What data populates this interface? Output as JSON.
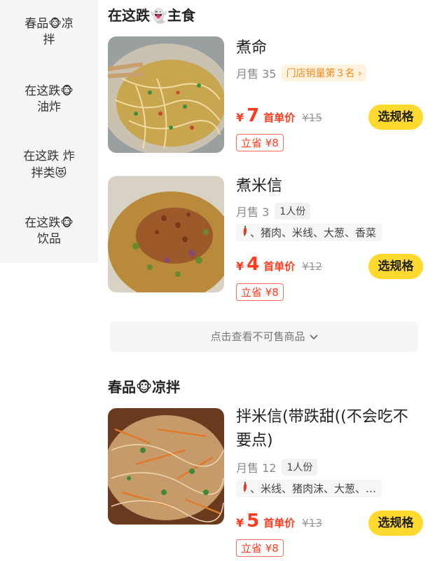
{
  "sidebar": {
    "items": [
      {
        "line1": "春品",
        "emoji1": "🐵",
        "line1b": "凉",
        "line2": "拌"
      },
      {
        "line1": "在这跌",
        "emoji1": "🐵",
        "line1b": "",
        "line2": "油炸"
      },
      {
        "line1": "在这跌 炸",
        "emoji1": "",
        "line1b": "",
        "line2": "拌类",
        "emoji2": "😻"
      },
      {
        "line1": "在这跌",
        "emoji1": "🐵",
        "line1b": "",
        "line2": "饮品"
      }
    ]
  },
  "sections": [
    {
      "title_pre": "在这跌",
      "title_emoji": "👻",
      "title_post": "主食"
    },
    {
      "title_pre": "春品",
      "title_emoji": "🐵",
      "title_post": "凉拌"
    }
  ],
  "dishes": [
    {
      "name": "煮命",
      "sales": "月售 35",
      "rank_badge": "门店销量第３名 ›",
      "currency": "¥",
      "price": "7",
      "price_unit": "首单价",
      "original_price": "¥15",
      "save": "立省 ¥8",
      "button": "选规格"
    },
    {
      "name": "煮米信",
      "sales": "月售 3",
      "serve": "1人份",
      "ingredients": "、猪肉、米线、大葱、香菜",
      "currency": "¥",
      "price": "4",
      "price_unit": "首单价",
      "original_price": "¥12",
      "save": "立省 ¥8",
      "button": "选规格"
    },
    {
      "name": "拌米信(带跌甜((不会吃不要点)",
      "sales": "月售 12",
      "serve": "1人份",
      "ingredients": "、米线、猪肉沫、大葱、…",
      "currency": "¥",
      "price": "5",
      "price_unit": "首单价",
      "original_price": "¥13",
      "save": "立省 ¥8",
      "button": "选规格"
    }
  ],
  "unsold_link": "点击查看不可售商品",
  "icons": {
    "chili": "chili-pepper-icon",
    "chevron": "chevron-down-icon",
    "rank_arrow": "chevron-right-icon"
  },
  "colors": {
    "accent": "#ff3b1f",
    "button": "#ffd92e",
    "rank": "#f08a1c"
  }
}
